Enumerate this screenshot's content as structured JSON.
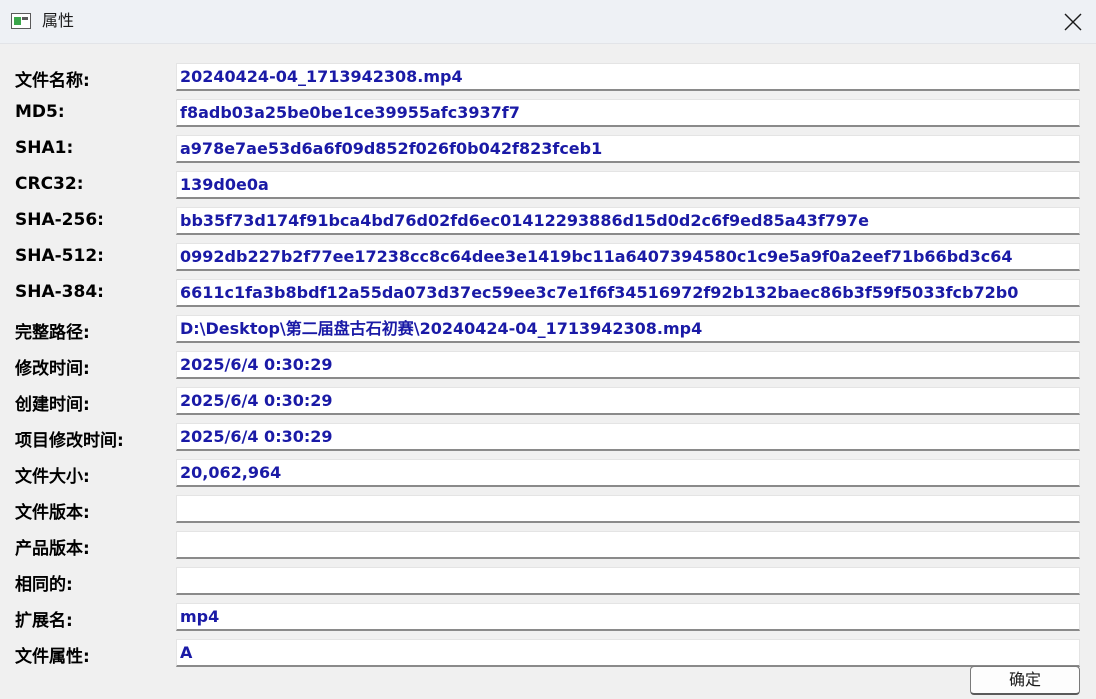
{
  "window": {
    "title": "属性",
    "icon": "app-window-icon",
    "close_icon": "close-icon"
  },
  "rows": [
    {
      "key": "file_name",
      "label": "文件名称:",
      "value": "20240424-04_1713942308.mp4"
    },
    {
      "key": "md5",
      "label": "MD5:",
      "value": "f8adb03a25be0be1ce39955afc3937f7"
    },
    {
      "key": "sha1",
      "label": "SHA1:",
      "value": "a978e7ae53d6a6f09d852f026f0b042f823fceb1"
    },
    {
      "key": "crc32",
      "label": "CRC32:",
      "value": "139d0e0a"
    },
    {
      "key": "sha256",
      "label": "SHA-256:",
      "value": "bb35f73d174f91bca4bd76d02fd6ec01412293886d15d0d2c6f9ed85a43f797e"
    },
    {
      "key": "sha512",
      "label": "SHA-512:",
      "value": "0992db227b2f77ee17238cc8c64dee3e1419bc11a6407394580c1c9e5a9f0a2eef71b66bd3c64"
    },
    {
      "key": "sha384",
      "label": "SHA-384:",
      "value": "6611c1fa3b8bdf12a55da073d37ec59ee3c7e1f6f34516972f92b132baec86b3f59f5033fcb72b0"
    },
    {
      "key": "full_path",
      "label": "完整路径:",
      "value": "D:\\Desktop\\第二届盘古石初赛\\20240424-04_1713942308.mp4"
    },
    {
      "key": "modified_time",
      "label": "修改时间:",
      "value": "2025/6/4 0:30:29"
    },
    {
      "key": "created_time",
      "label": "创建时间:",
      "value": "2025/6/4 0:30:29"
    },
    {
      "key": "entry_modified_time",
      "label": "项目修改时间:",
      "value": "2025/6/4 0:30:29"
    },
    {
      "key": "file_size",
      "label": "文件大小:",
      "value": "20,062,964"
    },
    {
      "key": "file_version",
      "label": "文件版本:",
      "value": ""
    },
    {
      "key": "product_version",
      "label": "产品版本:",
      "value": ""
    },
    {
      "key": "same",
      "label": "相同的:",
      "value": ""
    },
    {
      "key": "extension",
      "label": "扩展名:",
      "value": "mp4"
    },
    {
      "key": "attributes",
      "label": "文件属性:",
      "value": "A"
    }
  ],
  "buttons": {
    "ok_label": "确定"
  },
  "colors": {
    "value_text": "#1a1aa6",
    "label_text": "#000000",
    "background": "#f0f0f0"
  }
}
